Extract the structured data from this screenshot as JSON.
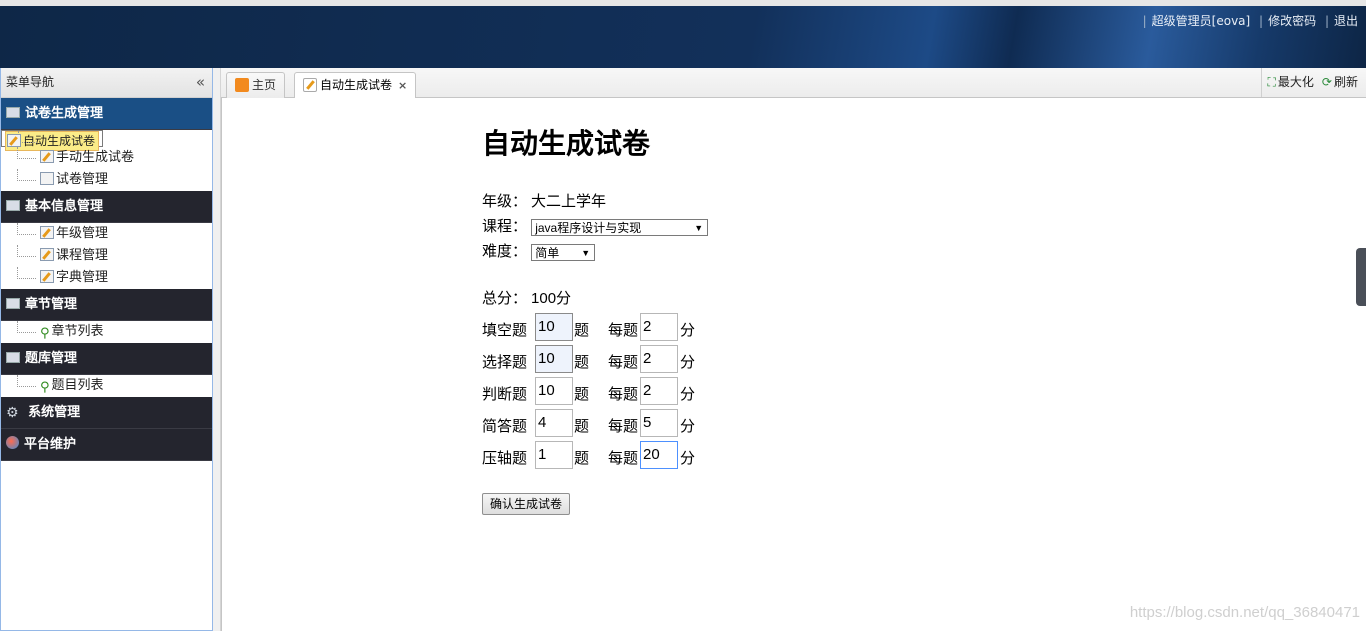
{
  "header": {
    "user": "超级管理员[eova]",
    "change_password": "修改密码",
    "logout": "退出"
  },
  "sidebar": {
    "title": "菜单导航",
    "collapse_icon": "«",
    "groups": [
      {
        "label": "试卷生成管理",
        "icon": "book-icon",
        "items": [
          {
            "label": "自动生成试卷",
            "icon": "edit-icon",
            "selected": true
          },
          {
            "label": "手动生成试卷",
            "icon": "edit-icon"
          },
          {
            "label": "试卷管理",
            "icon": "table-icon"
          }
        ]
      },
      {
        "label": "基本信息管理",
        "icon": "table-icon",
        "items": [
          {
            "label": "年级管理",
            "icon": "form-icon"
          },
          {
            "label": "课程管理",
            "icon": "form-icon"
          },
          {
            "label": "字典管理",
            "icon": "form-icon"
          }
        ]
      },
      {
        "label": "章节管理",
        "icon": "columns-icon",
        "items": [
          {
            "label": "章节列表",
            "icon": "tree-icon"
          }
        ]
      },
      {
        "label": "题库管理",
        "icon": "grid-icon",
        "items": [
          {
            "label": "题目列表",
            "icon": "tree-icon"
          }
        ]
      },
      {
        "label": "系统管理",
        "icon": "gear-icon",
        "items": []
      },
      {
        "label": "平台维护",
        "icon": "globe-icon",
        "items": []
      }
    ]
  },
  "tabs": [
    {
      "label": "主页",
      "icon": "rss-icon"
    },
    {
      "label": "自动生成试卷",
      "icon": "edit-icon",
      "active": true,
      "close": "×"
    }
  ],
  "tools": {
    "maximize": "最大化",
    "refresh": "刷新"
  },
  "form": {
    "title": "自动生成试卷",
    "grade_label": "年级：",
    "grade_value": "大二上学年",
    "course_label": "课程：",
    "course_value": "java程序设计与实现",
    "difficulty_label": "难度：",
    "difficulty_value": "简单",
    "total_label": "总分：",
    "total_value": "100分",
    "unit_count": "题",
    "per_label": "每题",
    "unit_score": "分",
    "questions": [
      {
        "label": "填空题",
        "count": "10",
        "score": "2"
      },
      {
        "label": "选择题",
        "count": "10",
        "score": "2"
      },
      {
        "label": "判断题",
        "count": "10",
        "score": "2"
      },
      {
        "label": "简答题",
        "count": "4",
        "score": "5"
      },
      {
        "label": "压轴题",
        "count": "1",
        "score": "20"
      }
    ],
    "submit": "确认生成试卷"
  },
  "watermark": "https://blog.csdn.net/qq_36840471"
}
